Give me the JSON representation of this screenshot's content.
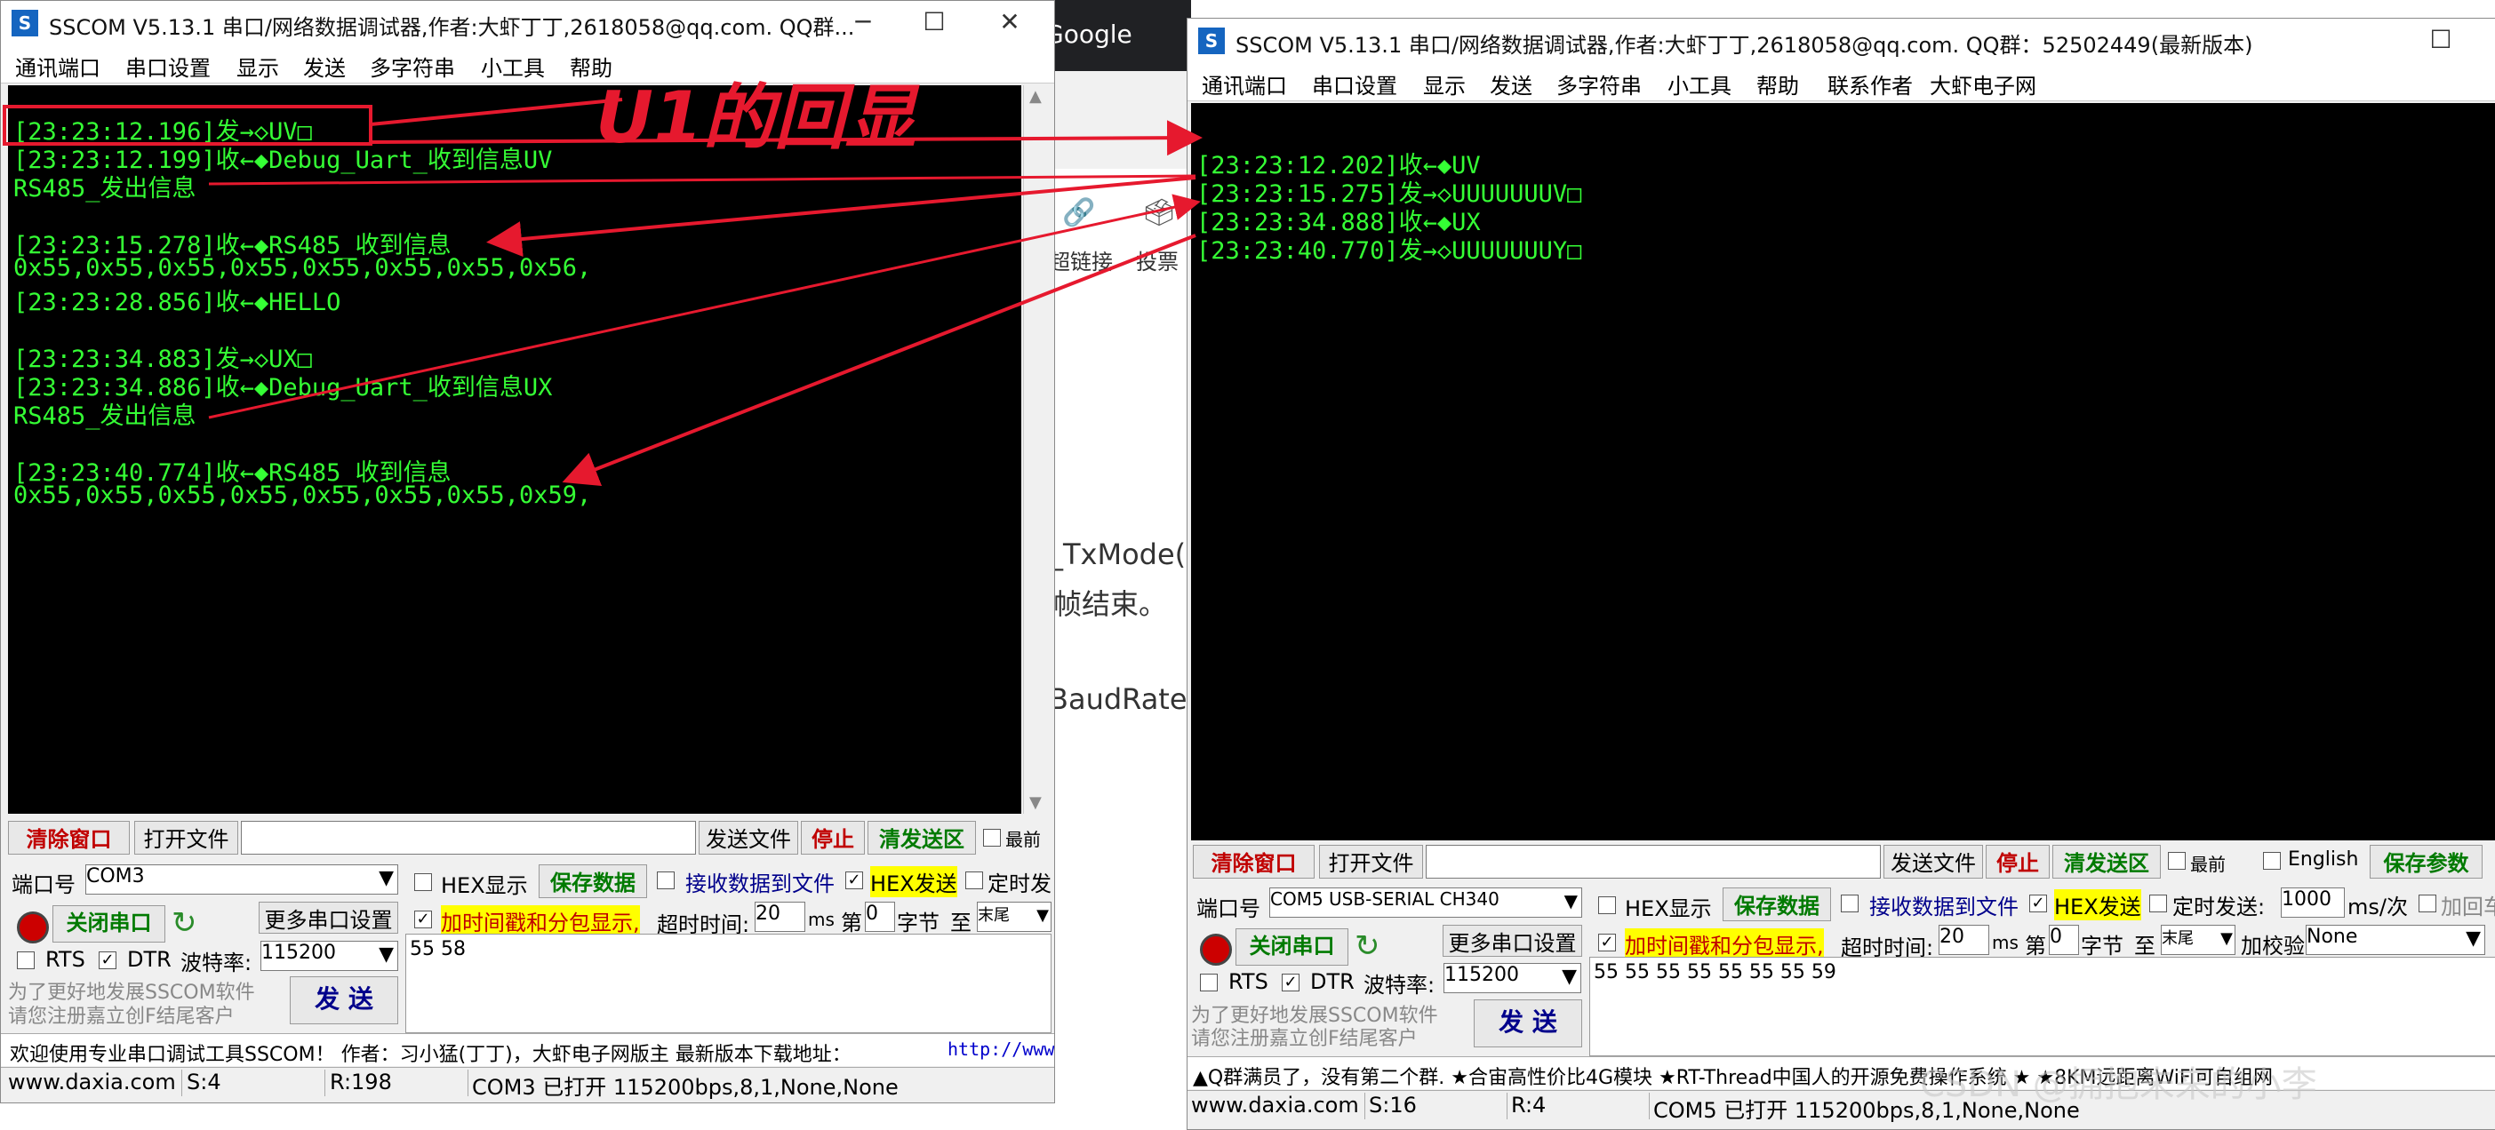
{
  "background": {
    "google_label": "Google",
    "toolbar_items": [
      "超链接",
      "投票"
    ],
    "text_lines": [
      "_TxMode()",
      "帧结束。",
      "BaudRate。"
    ]
  },
  "annotation": "U1的回显",
  "watermark": "CSDN @拥抱未来的小李",
  "left": {
    "title": "SSCOM V5.13.1 串口/网络数据调试器,作者:大虾丁丁,2618058@qq.com. QQ群...",
    "menu": [
      "通讯端口",
      "串口设置",
      "显示",
      "发送",
      "多字符串",
      "小工具",
      "帮助"
    ],
    "terminal_lines": [
      "[23:23:12.196]发→◇UV□",
      "[23:23:12.199]收←◆Debug_Uart_收到信息UV",
      "RS485_发出信息",
      "",
      "[23:23:15.278]收←◆RS485_收到信息",
      "0x55,0x55,0x55,0x55,0x55,0x55,0x55,0x56,",
      "[23:23:28.856]收←◆HELLO",
      "",
      "[23:23:34.883]发→◇UX□",
      "[23:23:34.886]收←◆Debug_Uart_收到信息UX",
      "RS485_发出信息",
      "",
      "[23:23:40.774]收←◆RS485_收到信息",
      "0x55,0x55,0x55,0x55,0x55,0x55,0x55,0x59,"
    ],
    "clear_btn": "清除窗口",
    "open_file_btn": "打开文件",
    "send_file_btn": "发送文件",
    "stop_btn": "停止",
    "clear_send_btn": "清发送区",
    "top_label": "最前",
    "port_label": "端口号",
    "port_value": "COM3",
    "hex_display": "HEX显示",
    "save_data": "保存数据",
    "recv_to_file": "接收数据到文件",
    "hex_send": "HEX发送",
    "timed_send": "定时发",
    "close_port_btn": "关闭串口",
    "more_settings": "更多串口设置",
    "timestamp_label": "加时间戳和分包显示,",
    "timeout_label": "超时时间:",
    "timeout_value": "20",
    "ms": "ms",
    "nth_label": "第",
    "nth_value": "0",
    "byte_label": "字节",
    "to_label": "至",
    "end_value": "末尾",
    "rts": "RTS",
    "dtr": "DTR",
    "baud_label": "波特率:",
    "baud_value": "115200",
    "send_text": "55 58",
    "promo1": "为了更好地发展SSCOM软件",
    "promo2": "请您注册嘉立创F结尾客户",
    "send_btn": "发 送",
    "info": "欢迎使用专业串口调试工具SSCOM！  作者：习小猛(丁丁)，大虾电子网版主  最新版本下载地址：",
    "info_link": "http://www",
    "status": [
      "www.daxia.com",
      "S:4",
      "R:198",
      "COM3 已打开  115200bps,8,1,None,None"
    ]
  },
  "right": {
    "title": "SSCOM V5.13.1 串口/网络数据调试器,作者:大虾丁丁,2618058@qq.com. QQ群：52502449(最新版本)",
    "menu": [
      "通讯端口",
      "串口设置",
      "显示",
      "发送",
      "多字符串",
      "小工具",
      "帮助",
      "联系作者",
      "大虾电子网"
    ],
    "terminal_lines": [
      "[23:23:12.202]收←◆UV",
      "[23:23:15.275]发→◇UUUUUUUV□",
      "[23:23:34.888]收←◆UX",
      "[23:23:40.770]发→◇UUUUUUUY□"
    ],
    "clear_btn": "清除窗口",
    "open_file_btn": "打开文件",
    "send_file_btn": "发送文件",
    "stop_btn": "停止",
    "clear_send_btn": "清发送区",
    "top_label": "最前",
    "english_label": "English",
    "save_params": "保存参数",
    "port_label": "端口号",
    "port_value": "COM5 USB-SERIAL CH340",
    "hex_display": "HEX显示",
    "save_data": "保存数据",
    "recv_to_file": "接收数据到文件",
    "hex_send": "HEX发送",
    "timed_send": "定时发送:",
    "timed_value": "1000",
    "timed_unit": "ms/次",
    "add_enter": "加回车",
    "close_port_btn": "关闭串口",
    "more_settings": "更多串口设置",
    "timestamp_label": "加时间戳和分包显示,",
    "timeout_label": "超时时间:",
    "timeout_value": "20",
    "ms": "ms",
    "nth_label": "第",
    "nth_value": "0",
    "byte_label": "字节",
    "to_label": "至",
    "end_value": "末尾",
    "checksum_label": "加校验",
    "checksum_value": "None",
    "rts": "RTS",
    "dtr": "DTR",
    "baud_label": "波特率:",
    "baud_value": "115200",
    "send_text": "55 55 55 55 55 55 55 59",
    "promo1": "为了更好地发展SSCOM软件",
    "promo2": "请您注册嘉立创F结尾客户",
    "send_btn": "发 送",
    "info": "▲Q群满员了，没有第二个群. ★合宙高性价比4G模块 ★RT-Thread中国人的开源免费操作系统 ★ ★8KM远距离WiFi可自组网",
    "status": [
      "www.daxia.com",
      "S:16",
      "R:4",
      "COM5 已打开  115200bps,8,1,None,None"
    ]
  }
}
